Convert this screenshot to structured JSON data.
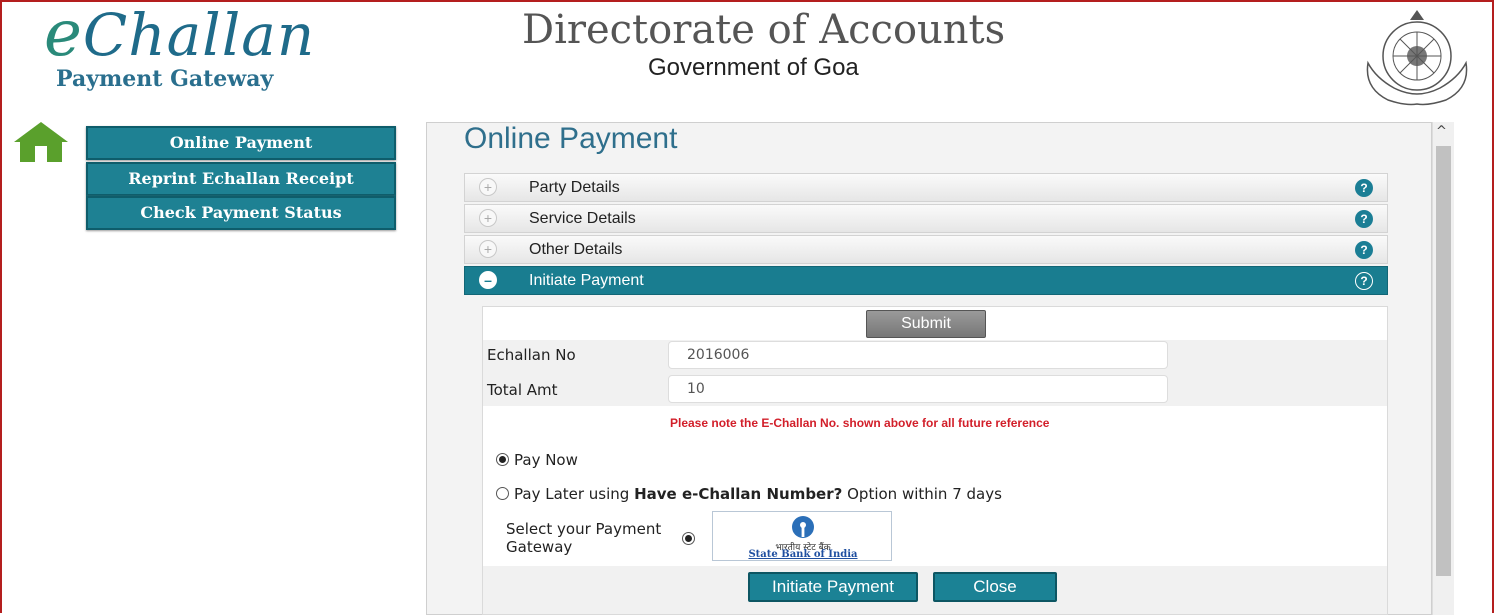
{
  "header": {
    "logo_e": "e",
    "logo_rest": "Challan",
    "logo_sub": "Payment Gateway",
    "title": "Directorate of Accounts",
    "subtitle": "Government of Goa"
  },
  "sidebar": {
    "items": [
      {
        "label": "Online Payment"
      },
      {
        "label": "Reprint Echallan Receipt"
      },
      {
        "label": "Check Payment Status"
      }
    ]
  },
  "panel": {
    "title": "Online Payment",
    "sections": [
      {
        "label": "Party Details",
        "help": "?"
      },
      {
        "label": "Service Details",
        "help": "?"
      },
      {
        "label": "Other Details",
        "help": "?"
      },
      {
        "label": "Initiate Payment",
        "help": "?"
      }
    ],
    "submit_label": "Submit",
    "echallan_label": "Echallan No",
    "echallan_value": "2016006",
    "amount_label": "Total Amt",
    "amount_value": "10",
    "note": "Please note the E-Challan No. shown above for all future reference",
    "pay_now": "Pay Now",
    "pay_later_prefix": "Pay Later using ",
    "pay_later_bold": "Have e-Challan Number?",
    "pay_later_suffix": " Option within 7 days",
    "gateway_label": "Select your Payment Gateway",
    "sbi_hindi": "भारतीय स्टेट बैंक",
    "sbi_english": "State Bank of India",
    "initiate_label": "Initiate Payment",
    "close_label": "Close"
  },
  "colors": {
    "teal": "#1b8295",
    "frame_red": "#b41e1e",
    "note_red": "#d21f2a"
  }
}
